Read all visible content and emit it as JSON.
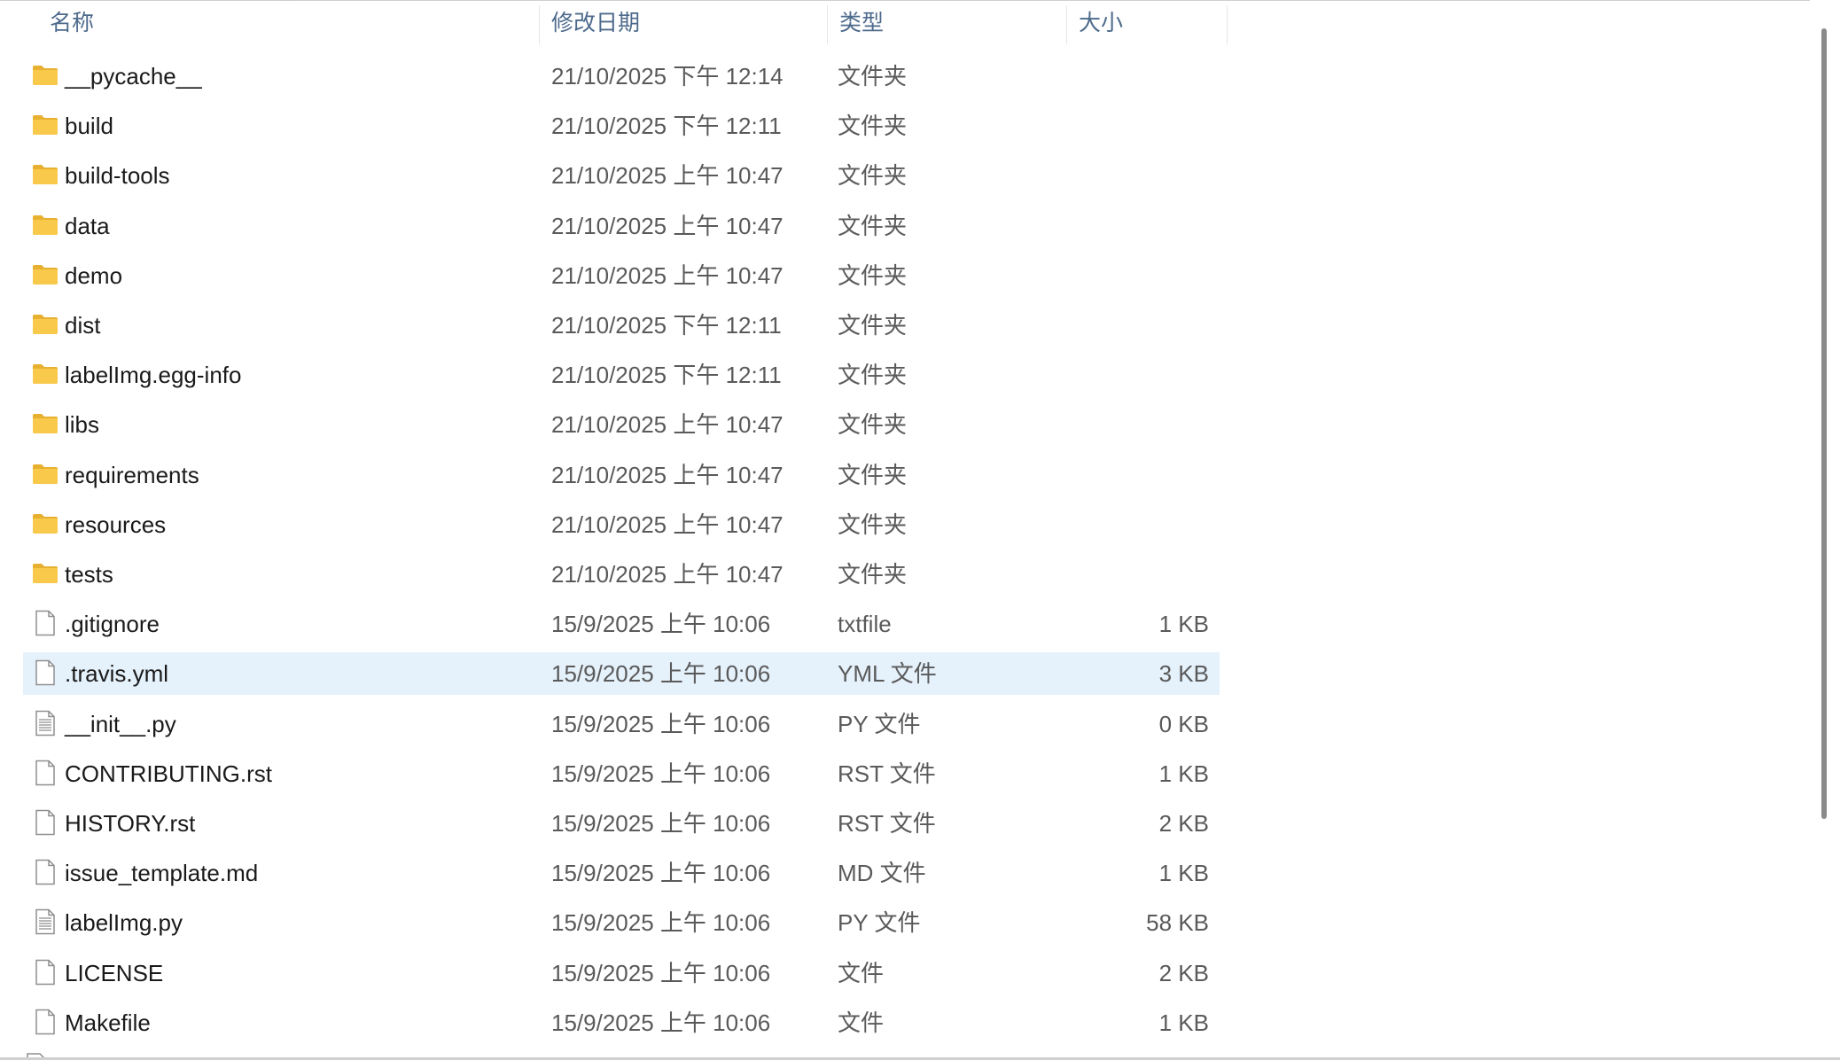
{
  "columns": {
    "name": "名称",
    "date": "修改日期",
    "type": "类型",
    "size": "大小"
  },
  "sort_indicator": "^",
  "files": [
    {
      "name": "__pycache__",
      "date": "21/10/2025 下午 12:14",
      "type": "文件夹",
      "size": "",
      "icon": "folder-icon"
    },
    {
      "name": "build",
      "date": "21/10/2025 下午 12:11",
      "type": "文件夹",
      "size": "",
      "icon": "folder-icon"
    },
    {
      "name": "build-tools",
      "date": "21/10/2025 上午 10:47",
      "type": "文件夹",
      "size": "",
      "icon": "folder-icon"
    },
    {
      "name": "data",
      "date": "21/10/2025 上午 10:47",
      "type": "文件夹",
      "size": "",
      "icon": "folder-icon"
    },
    {
      "name": "demo",
      "date": "21/10/2025 上午 10:47",
      "type": "文件夹",
      "size": "",
      "icon": "folder-icon"
    },
    {
      "name": "dist",
      "date": "21/10/2025 下午 12:11",
      "type": "文件夹",
      "size": "",
      "icon": "folder-icon"
    },
    {
      "name": "labelImg.egg-info",
      "date": "21/10/2025 下午 12:11",
      "type": "文件夹",
      "size": "",
      "icon": "folder-icon"
    },
    {
      "name": "libs",
      "date": "21/10/2025 上午 10:47",
      "type": "文件夹",
      "size": "",
      "icon": "folder-icon"
    },
    {
      "name": "requirements",
      "date": "21/10/2025 上午 10:47",
      "type": "文件夹",
      "size": "",
      "icon": "folder-icon"
    },
    {
      "name": "resources",
      "date": "21/10/2025 上午 10:47",
      "type": "文件夹",
      "size": "",
      "icon": "folder-icon"
    },
    {
      "name": "tests",
      "date": "21/10/2025 上午 10:47",
      "type": "文件夹",
      "size": "",
      "icon": "folder-icon"
    },
    {
      "name": ".gitignore",
      "date": "15/9/2025 上午 10:06",
      "type": "txtfile",
      "size": "1 KB",
      "icon": "file-icon"
    },
    {
      "name": ".travis.yml",
      "date": "15/9/2025 上午 10:06",
      "type": "YML 文件",
      "size": "3 KB",
      "icon": "file-icon",
      "selected": true
    },
    {
      "name": "__init__.py",
      "date": "15/9/2025 上午 10:06",
      "type": "PY 文件",
      "size": "0 KB",
      "icon": "text-file-icon"
    },
    {
      "name": "CONTRIBUTING.rst",
      "date": "15/9/2025 上午 10:06",
      "type": "RST 文件",
      "size": "1 KB",
      "icon": "file-icon"
    },
    {
      "name": "HISTORY.rst",
      "date": "15/9/2025 上午 10:06",
      "type": "RST 文件",
      "size": "2 KB",
      "icon": "file-icon"
    },
    {
      "name": "issue_template.md",
      "date": "15/9/2025 上午 10:06",
      "type": "MD 文件",
      "size": "1 KB",
      "icon": "file-icon"
    },
    {
      "name": "labelImg.py",
      "date": "15/9/2025 上午 10:06",
      "type": "PY 文件",
      "size": "58 KB",
      "icon": "text-file-icon"
    },
    {
      "name": "LICENSE",
      "date": "15/9/2025 上午 10:06",
      "type": "文件",
      "size": "2 KB",
      "icon": "file-icon"
    },
    {
      "name": "Makefile",
      "date": "15/9/2025 上午 10:06",
      "type": "文件",
      "size": "1 KB",
      "icon": "file-icon"
    }
  ],
  "colors": {
    "header_text": "#4d6a8c",
    "selected_row": "#e5f1fb",
    "folder": "#f8c94a",
    "folder_dark": "#e8b030"
  }
}
